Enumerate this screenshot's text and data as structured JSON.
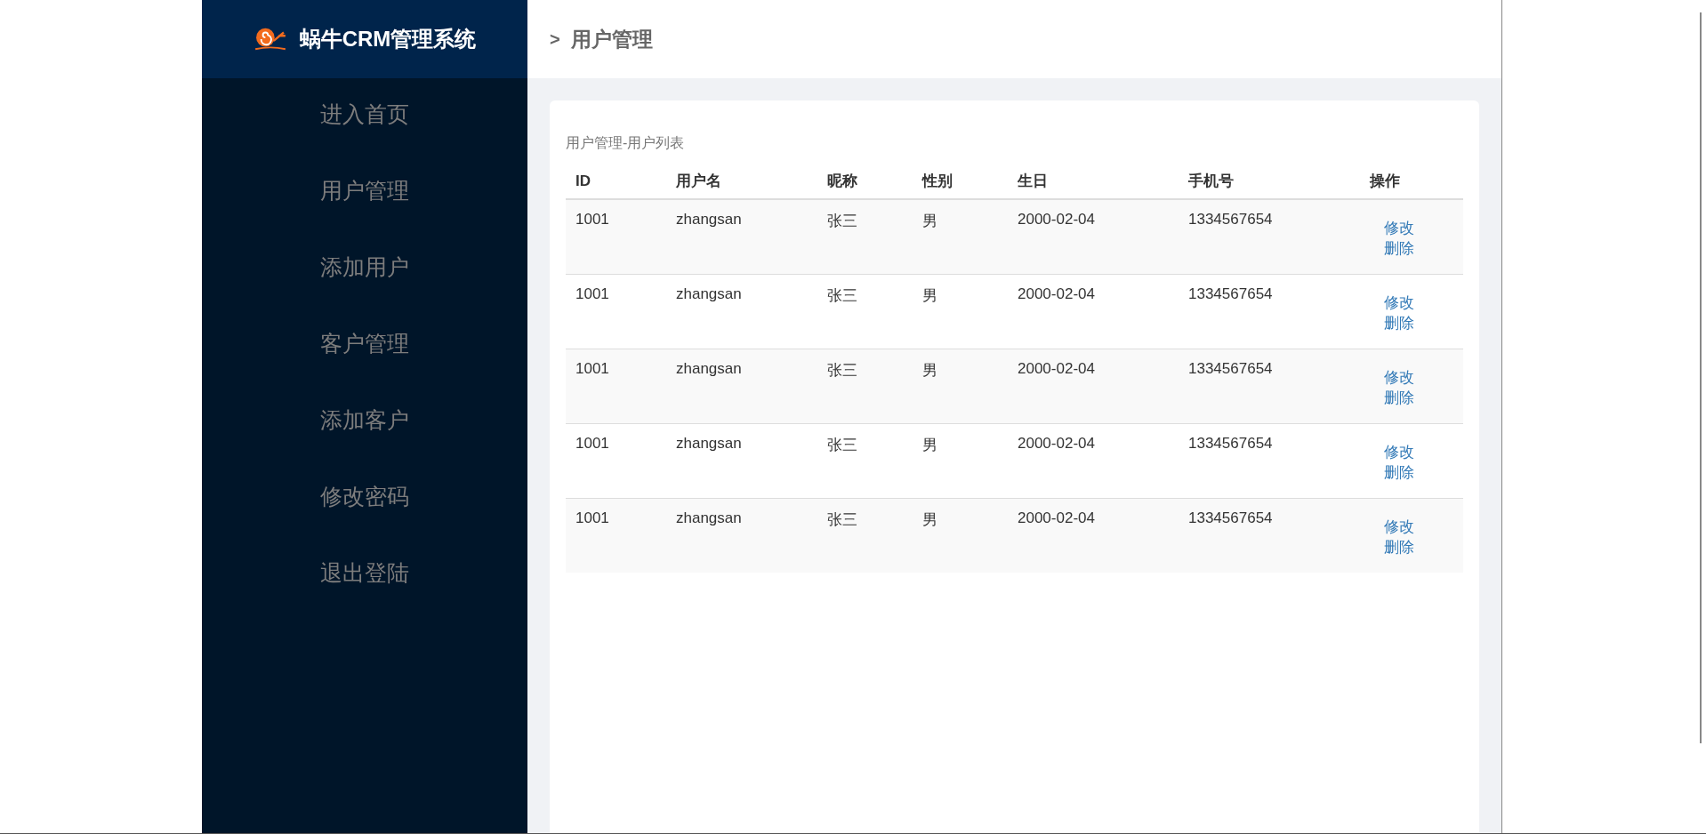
{
  "brand": {
    "title": "蜗牛CRM管理系统"
  },
  "sidebar": {
    "items": [
      {
        "label": "进入首页"
      },
      {
        "label": "用户管理"
      },
      {
        "label": "添加用户"
      },
      {
        "label": "客户管理"
      },
      {
        "label": "添加客户"
      },
      {
        "label": "修改密码"
      },
      {
        "label": "退出登陆"
      }
    ]
  },
  "breadcrumb": {
    "separator": ">",
    "current": "用户管理"
  },
  "panel": {
    "caption": "用户管理-用户列表"
  },
  "table": {
    "columns": [
      "ID",
      "用户名",
      "昵称",
      "性别",
      "生日",
      "手机号",
      "操作"
    ],
    "rows": [
      {
        "cells": [
          "1001",
          "zhangsan",
          "张三",
          "男",
          "2000-02-04",
          "1334567654"
        ],
        "actions": [
          "修改",
          "删除"
        ]
      },
      {
        "cells": [
          "1001",
          "zhangsan",
          "张三",
          "男",
          "2000-02-04",
          "1334567654"
        ],
        "actions": [
          "修改",
          "删除"
        ]
      },
      {
        "cells": [
          "1001",
          "zhangsan",
          "张三",
          "男",
          "2000-02-04",
          "1334567654"
        ],
        "actions": [
          "修改",
          "删除"
        ]
      },
      {
        "cells": [
          "1001",
          "zhangsan",
          "张三",
          "男",
          "2000-02-04",
          "1334567654"
        ],
        "actions": [
          "修改",
          "删除"
        ]
      },
      {
        "cells": [
          "1001",
          "zhangsan",
          "张三",
          "男",
          "2000-02-04",
          "1334567654"
        ],
        "actions": [
          "修改",
          "删除"
        ]
      }
    ]
  }
}
